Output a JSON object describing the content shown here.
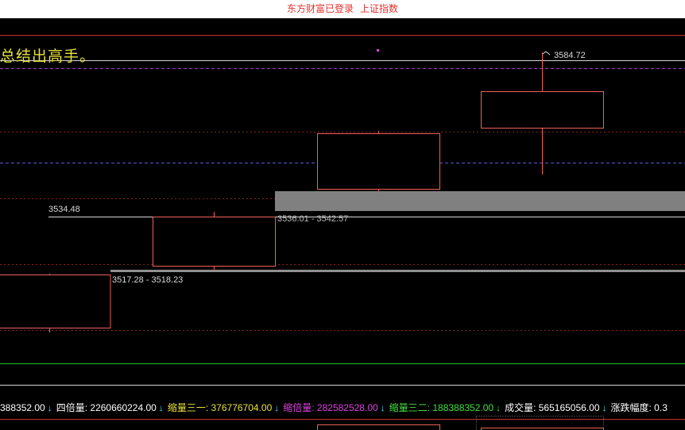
{
  "title": {
    "app": "东方财富已登录",
    "index": "上证指数"
  },
  "banner": "总结出高手。",
  "price_labels": {
    "high": "3584.72",
    "level_mid": "3534.48",
    "gap_upper": "3536.01 - 3542.57",
    "gap_lower": "3517.28 - 3518.23"
  },
  "status_bar": [
    {
      "text": "388352.00",
      "color": "#ffffff"
    },
    {
      "text": "四倍量: 2260660224.00",
      "color": "#ffffff"
    },
    {
      "text": "缩量三一: 376776704.00",
      "color": "#e8e23a"
    },
    {
      "text": "缩倍量: 282582528.00",
      "color": "#e040e0"
    },
    {
      "text": "缩量三二: 188388352.00",
      "color": "#3ee23e"
    },
    {
      "text": "成交量: 565165056.00",
      "color": "#ffffff"
    },
    {
      "text": "涨跌幅度: 0.3",
      "color": "#ffffff"
    }
  ],
  "arrow_symbol": "↓",
  "colors": {
    "candle": "#f0605a",
    "grid_red": "#c83030",
    "grid_purple": "#9b3cd0",
    "grid_blue": "#5a5ad8",
    "gap_gray": "#808080",
    "green_line": "#22c22e"
  }
}
